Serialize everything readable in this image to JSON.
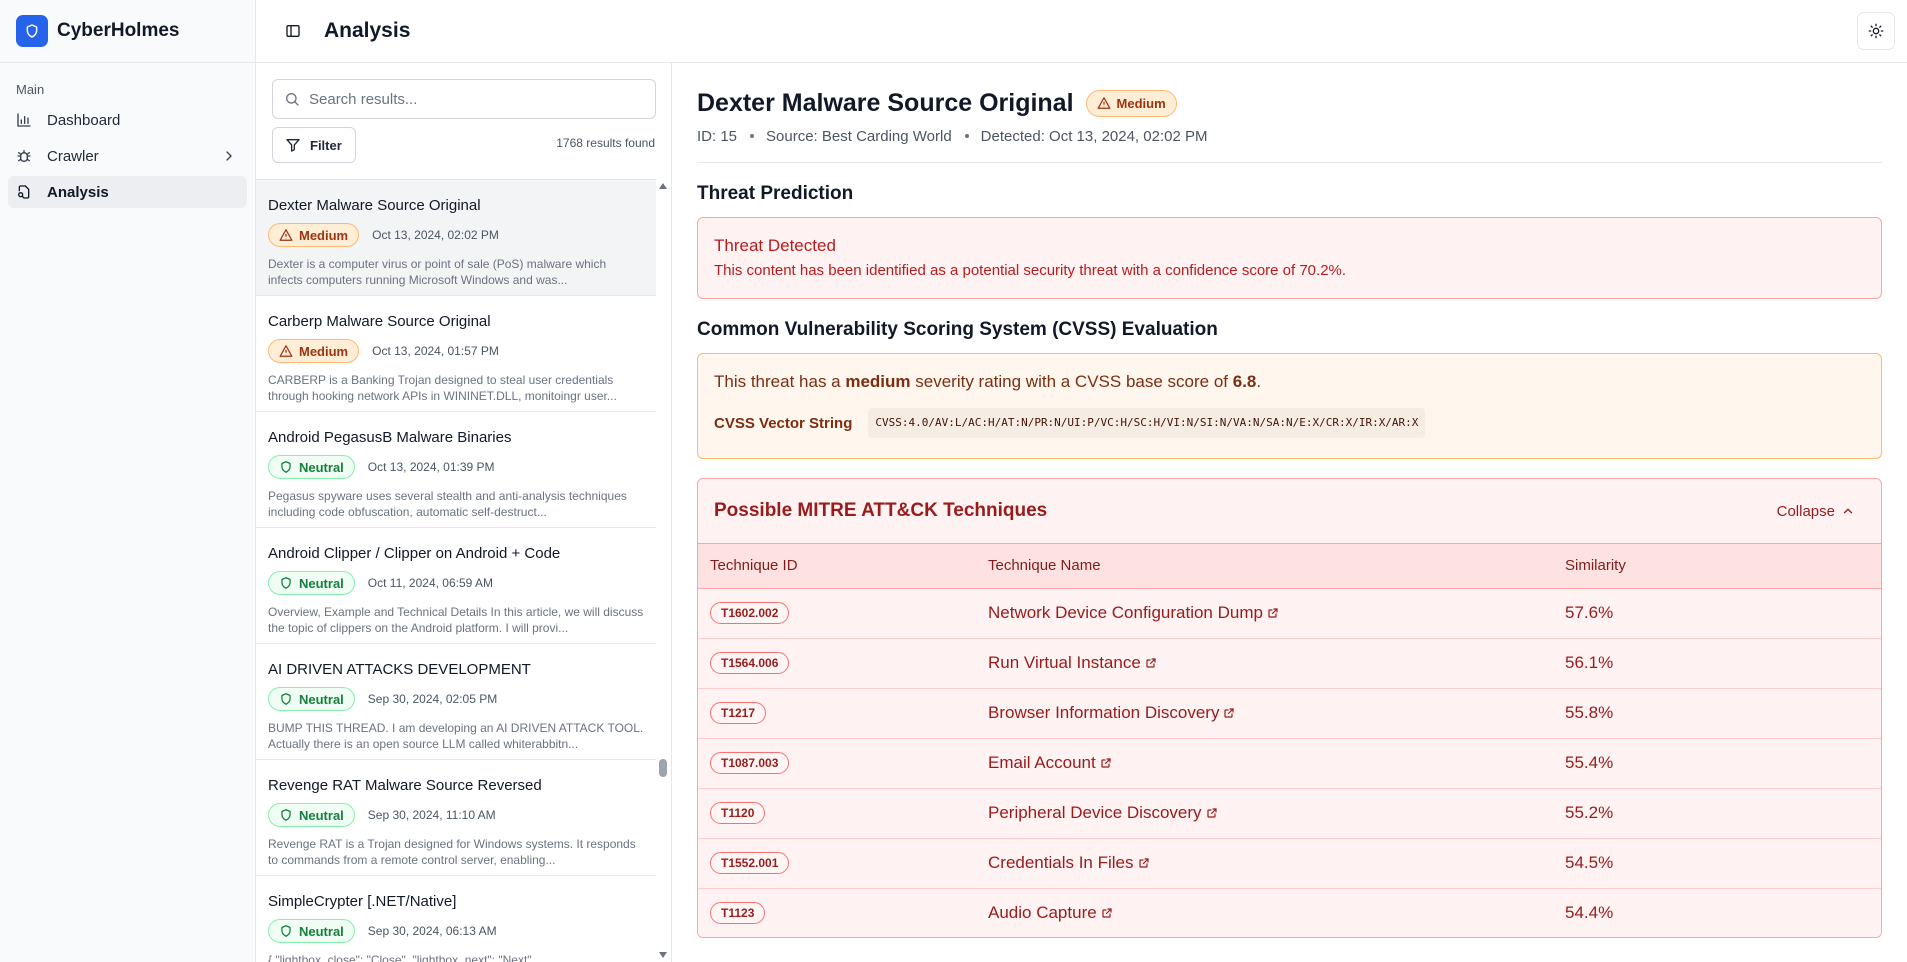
{
  "app": {
    "name": "CyberHolmes"
  },
  "header": {
    "title": "Analysis"
  },
  "sidebar": {
    "section_label": "Main",
    "items": [
      {
        "label": "Dashboard",
        "icon": "bar-chart-icon"
      },
      {
        "label": "Crawler",
        "icon": "bug-icon"
      },
      {
        "label": "Analysis",
        "icon": "file-search-icon"
      }
    ]
  },
  "list": {
    "search_placeholder": "Search results...",
    "filter_label": "Filter",
    "results_count": "1768 results found",
    "items": [
      {
        "title": "Dexter Malware Source Original",
        "severity": "Medium",
        "date": "Oct 13, 2024, 02:02 PM",
        "description": "Dexter is a computer virus or point of sale (PoS) malware which infects computers running Microsoft Windows and was..."
      },
      {
        "title": "Carberp Malware Source Original",
        "severity": "Medium",
        "date": "Oct 13, 2024, 01:57 PM",
        "description": "CARBERP is a Banking Trojan designed to steal user credentials through hooking network APIs in WININET.DLL, monitoingr user..."
      },
      {
        "title": "Android PegasusB Malware Binaries",
        "severity": "Neutral",
        "date": "Oct 13, 2024, 01:39 PM",
        "description": "Pegasus spyware uses several stealth and anti-analysis techniques including code obfuscation, automatic self-destruct..."
      },
      {
        "title": "Android Clipper / Clipper on Android + Code",
        "severity": "Neutral",
        "date": "Oct 11, 2024, 06:59 AM",
        "description": "Overview, Example and Technical Details In this article, we will discuss the topic of clippers on the Android platform. I will provi..."
      },
      {
        "title": "AI DRIVEN ATTACKS DEVELOPMENT",
        "severity": "Neutral",
        "date": "Sep 30, 2024, 02:05 PM",
        "description": "BUMP THIS THREAD. I am developing an AI DRIVEN ATTACK TOOL. Actually there is an open source LLM called whiterabbitn..."
      },
      {
        "title": "Revenge RAT Malware Source Reversed",
        "severity": "Neutral",
        "date": "Sep 30, 2024, 11:10 AM",
        "description": "Revenge RAT is a Trojan designed for Windows systems. It responds to commands from a remote control server, enabling..."
      },
      {
        "title": "SimpleCrypter [.NET/Native]",
        "severity": "Neutral",
        "date": "Sep 30, 2024, 06:13 AM",
        "description": "{ \"lightbox_close\": \"Close\", \"lightbox_next\": \"Next\","
      }
    ]
  },
  "detail": {
    "title": "Dexter Malware Source Original",
    "severity": "Medium",
    "id_text": "ID: 15",
    "source_text": "Source: Best Carding World",
    "detected_text": "Detected: Oct 13, 2024, 02:02 PM",
    "threat_section_title": "Threat Prediction",
    "threat_title": "Threat Detected",
    "threat_text": "This content has been identified as a potential security threat with a confidence score of 70.2%.",
    "cvss_section_title": "Common Vulnerability Scoring System (CVSS) Evaluation",
    "cvss_text_1": "This threat has a ",
    "cvss_severity": "medium",
    "cvss_text_2": " severity rating with a CVSS base score of ",
    "cvss_score": "6.8",
    "cvss_text_3": ".",
    "cvss_vector_label": "CVSS Vector String",
    "cvss_vector": "CVSS:4.0/AV:L/AC:H/AT:N/PR:N/UI:P/VC:H/SC:H/VI:N/SI:N/VA:N/SA:N/E:X/CR:X/IR:X/AR:X",
    "mitre_title": "Possible MITRE ATT&CK Techniques",
    "collapse_label": "Collapse",
    "table_headers": [
      "Technique ID",
      "Technique Name",
      "Similarity"
    ],
    "techniques": [
      {
        "id": "T1602.002",
        "name": "Network Device Configuration Dump",
        "similarity": "57.6%"
      },
      {
        "id": "T1564.006",
        "name": "Run Virtual Instance",
        "similarity": "56.1%"
      },
      {
        "id": "T1217",
        "name": "Browser Information Discovery",
        "similarity": "55.8%"
      },
      {
        "id": "T1087.003",
        "name": "Email Account",
        "similarity": "55.4%"
      },
      {
        "id": "T1120",
        "name": "Peripheral Device Discovery",
        "similarity": "55.2%"
      },
      {
        "id": "T1552.001",
        "name": "Credentials In Files",
        "similarity": "54.5%"
      },
      {
        "id": "T1123",
        "name": "Audio Capture",
        "similarity": "54.4%"
      }
    ]
  },
  "colors": {
    "brand": "#2563eb",
    "medium_badge": "#ffedd5",
    "neutral_badge": "#f0fdf4",
    "threat_red": "#b91c1c"
  }
}
